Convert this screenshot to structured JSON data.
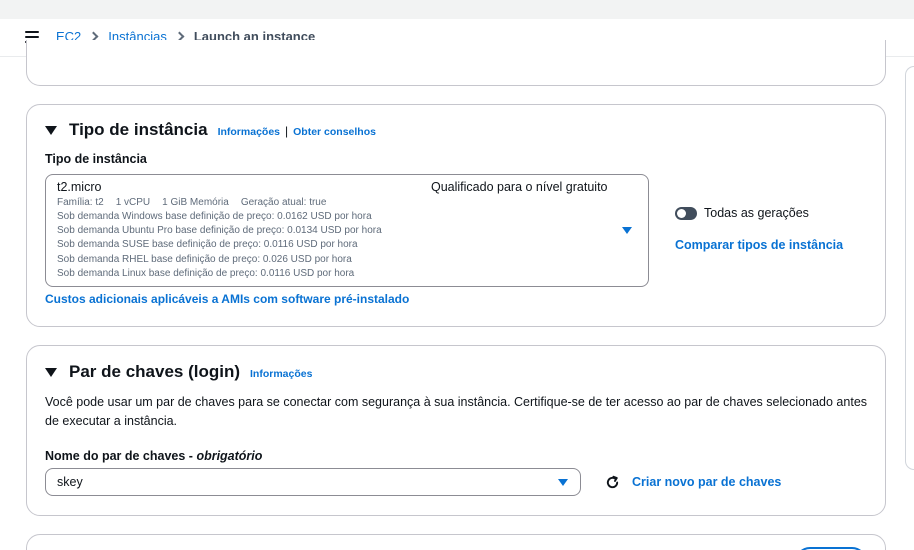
{
  "breadcrumb": {
    "items": [
      "EC2",
      "Instâncias"
    ],
    "current": "Launch an instance"
  },
  "instance_type_section": {
    "title": "Tipo de instância",
    "info_link": "Informações",
    "separator": "|",
    "advice_link": "Obter conselhos",
    "field_label": "Tipo de instância",
    "selected": {
      "name": "t2.micro",
      "free_tier": "Qualificado para o nível gratuito",
      "meta": [
        "Família: t2",
        "1 vCPU",
        "1 GiB Memória",
        "Geração atual: true"
      ],
      "prices": [
        "Sob demanda Windows base definição de preço: 0.0162 USD por hora",
        "Sob demanda Ubuntu Pro base definição de preço: 0.0134 USD por hora",
        "Sob demanda SUSE base definição de preço: 0.0116 USD por hora",
        "Sob demanda RHEL base definição de preço: 0.026 USD por hora",
        "Sob demanda Linux base definição de preço: 0.0116 USD por hora"
      ]
    },
    "all_generations_label": "Todas as gerações",
    "all_generations_on": false,
    "compare_link": "Comparar tipos de instância",
    "cost_link": "Custos adicionais aplicáveis a AMIs com software pré-instalado"
  },
  "key_pair_section": {
    "title": "Par de chaves (login)",
    "info_link": "Informações",
    "description": "Você pode usar um par de chaves para se conectar com segurança à sua instância. Certifique-se de ter acesso ao par de chaves selecionado antes de executar a instância.",
    "field_label": "Nome do par de chaves - ",
    "field_label_required": "obrigatório",
    "selected_key": "skey",
    "create_link": "Criar novo par de chaves"
  },
  "colors": {
    "link": "#0972d3",
    "text": "#0f141a",
    "secondary_text": "#5f6b7a",
    "border": "#c6c6cd",
    "toggle_off": "#414d5c"
  },
  "icons": [
    "menu-icon",
    "chevron-right-icon",
    "caret-down-icon",
    "triangle-down-icon",
    "refresh-icon"
  ]
}
